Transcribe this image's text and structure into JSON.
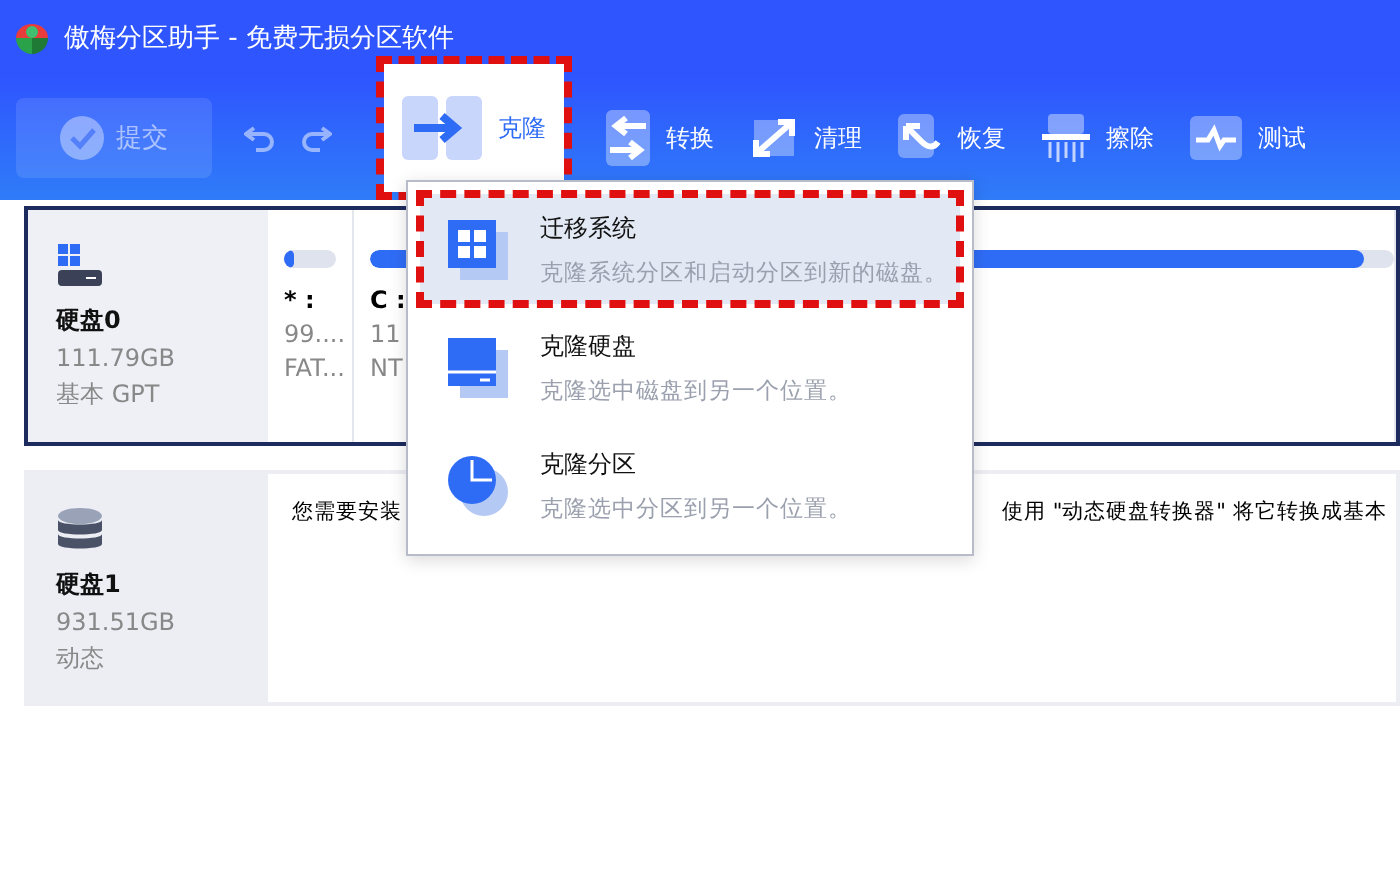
{
  "window": {
    "title": "傲梅分区助手 - 免费无损分区软件"
  },
  "toolbar": [
    {
      "kind": "submit",
      "label": "提交",
      "disabled": true
    },
    {
      "kind": "undo",
      "disabled": true
    },
    {
      "kind": "redo",
      "disabled": true
    },
    {
      "kind": "clone",
      "label": "克隆",
      "active": true
    },
    {
      "kind": "convert",
      "label": "转换",
      "active": false
    },
    {
      "kind": "clean",
      "label": "清理",
      "active": false
    },
    {
      "kind": "recover",
      "label": "恢复",
      "active": false
    },
    {
      "kind": "wipe",
      "label": "擦除",
      "active": false
    },
    {
      "kind": "test",
      "label": "测试",
      "active": false
    }
  ],
  "disks": [
    {
      "kind": "basic",
      "name": "硬盘0",
      "size": "111.79GB",
      "type": "基本 GPT",
      "selected": true,
      "partitions": [
        {
          "letter": "* :",
          "size": "99....",
          "fs": "FAT...",
          "level": 0.2
        },
        {
          "letter": "C :",
          "size": "11",
          "fs": "NT",
          "level": 0.97
        }
      ]
    },
    {
      "kind": "dynamic",
      "name": "硬盘1",
      "size": "931.51GB",
      "type": "动态",
      "selected": false,
      "message": [
        "您需要安装",
        "使用 \"动态硬盘转换器\" 将它转换成基本"
      ]
    }
  ],
  "clone_menu": [
    {
      "kind": "system",
      "title": "迁移系统",
      "description": "克隆系统分区和启动分区到新的磁盘。",
      "selected": true
    },
    {
      "kind": "disk",
      "title": "克隆硬盘",
      "description": "克隆选中磁盘到另一个位置。",
      "selected": false
    },
    {
      "kind": "partition",
      "title": "克隆分区",
      "description": "克隆选中分区到另一个位置。",
      "selected": false
    }
  ]
}
